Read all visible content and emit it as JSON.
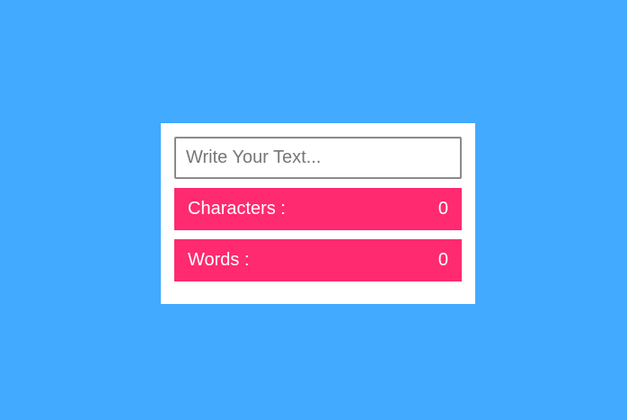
{
  "input": {
    "placeholder": "Write Your Text...",
    "value": ""
  },
  "stats": {
    "characters": {
      "label": "Characters :",
      "value": "0"
    },
    "words": {
      "label": "Words :",
      "value": "0"
    }
  },
  "colors": {
    "background": "#42aaff",
    "card": "#ffffff",
    "stat_row": "#ff2a70",
    "input_border": "#8a8a8a"
  }
}
